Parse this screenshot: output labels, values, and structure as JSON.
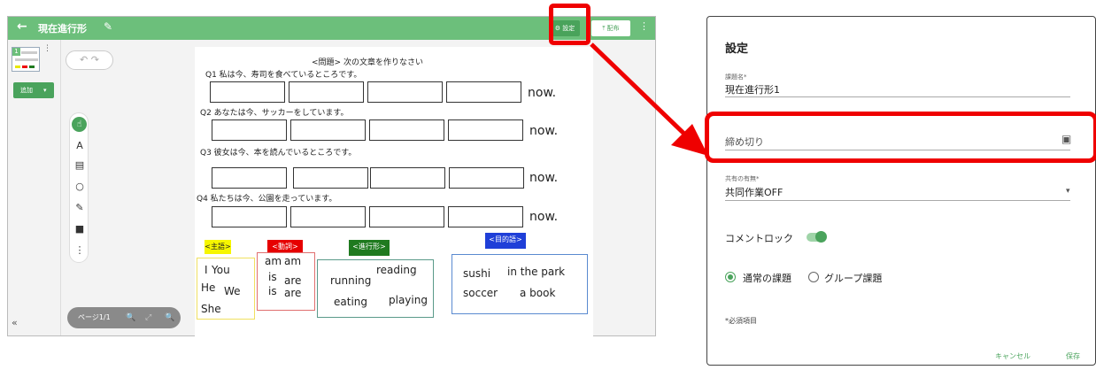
{
  "app": {
    "back_icon": "←",
    "title": "現在進行形",
    "settings_label": "⚙ 設定",
    "distribute_label": "⤒ 配布",
    "more_icon": "⋮",
    "add_label": "追加",
    "add_caret": "▾",
    "collapse_icon": "«",
    "thumb_badge": "1",
    "thumb_more": "⋮"
  },
  "canvas": {
    "undo": "↶ ↷",
    "pager_label": "ページ1/1",
    "zoom_out": "🔍",
    "fit": "⤢",
    "zoom_in": "🔍",
    "tools": [
      "A",
      "▤",
      "○",
      "✎",
      "■",
      "⋮"
    ],
    "hand_icon": "☝"
  },
  "worksheet": {
    "header": "<問題> 次の文章を作りなさい",
    "now": "now.",
    "questions": [
      "Q1 私は今、寿司を食べているところです。",
      "Q2 あなたは今、サッカーをしています。",
      "Q3 彼女は今、本を読んでいるところです。",
      "Q4 私たちは今、公園を走っています。"
    ],
    "tags": {
      "subject": "<主語>",
      "verb": "<動詞>",
      "progressive": "<進行形>",
      "object": "<目的語>"
    },
    "words": {
      "i": "I",
      "you": "You",
      "he": "He",
      "we": "We",
      "she": "She",
      "am1": "am",
      "am2": "am",
      "is1": "is",
      "are1": "are",
      "is2": "is",
      "are2": "are",
      "running": "running",
      "reading": "reading",
      "eating": "eating",
      "playing": "playing",
      "sushi": "sushi",
      "park": "in the park",
      "soccer": "soccer",
      "book": "a book"
    }
  },
  "settings": {
    "title": "設定",
    "task_label": "課題名*",
    "task_value": "現在進行形1",
    "deadline_placeholder": "締め切り",
    "calendar_icon": "▣",
    "share_label": "共有の有無*",
    "share_value": "共同作業OFF",
    "share_caret": "▾",
    "comment_lock": "コメントロック",
    "radio_normal": "通常の課題",
    "radio_group": "グループ課題",
    "required_note": "*必須項目",
    "cancel": "キャンセル",
    "save": "保存"
  },
  "colors": {
    "brand": "#6cbf7b",
    "accent": "#4aa35c",
    "highlight": "#ef0000"
  }
}
